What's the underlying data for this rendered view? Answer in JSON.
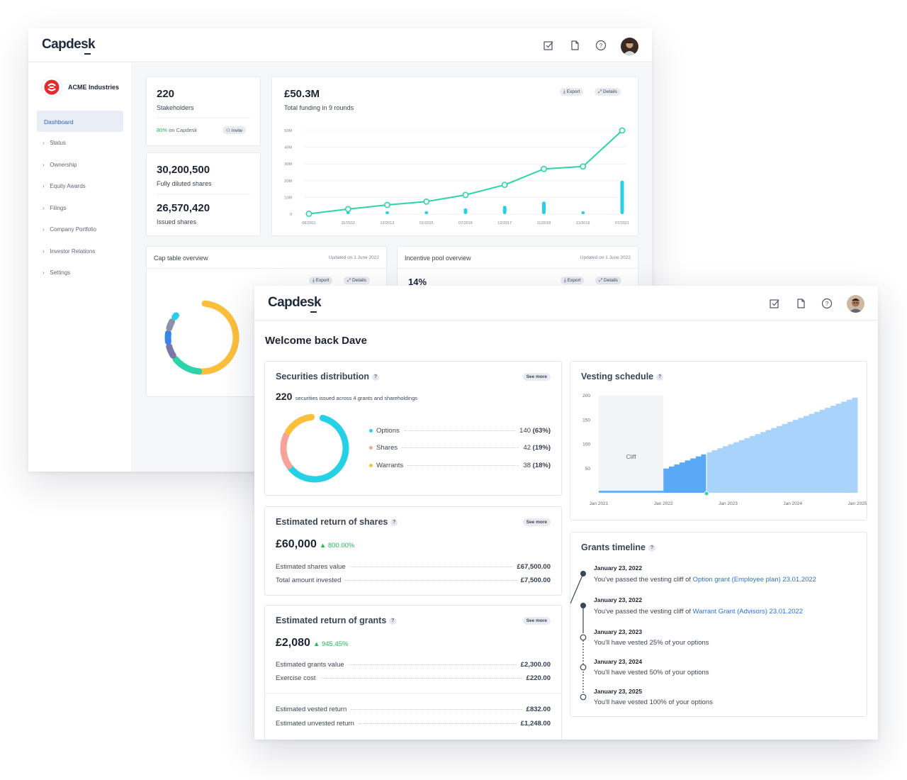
{
  "colors": {
    "teal": "#2dd4a7",
    "cyan": "#26d1e6",
    "accent_blue": "#2e5fc0",
    "amber": "#fbbf3c",
    "salmon": "#f6a39b",
    "green": "#1fba57"
  },
  "back": {
    "logo": "Capdesk",
    "topbar_icons": [
      "checkbox-icon",
      "document-icon",
      "help-icon"
    ],
    "company_name": "ACME Industries",
    "nav": [
      {
        "label": "Dashboard",
        "active": true
      },
      {
        "label": "Status"
      },
      {
        "label": "Ownership"
      },
      {
        "label": "Equity Awards"
      },
      {
        "label": "Filings"
      },
      {
        "label": "Company Portfolio"
      },
      {
        "label": "Investor Relations"
      },
      {
        "label": "Settings"
      }
    ],
    "stakeholders": {
      "value": "220",
      "label": "Stakeholders",
      "pct": "80%",
      "pct_suffix": "on Capdesk",
      "invite": "Invite"
    },
    "shares": {
      "diluted_value": "30,200,500",
      "diluted_label": "Fully diluted shares",
      "issued_value": "26,570,420",
      "issued_label": "Issued shares"
    },
    "funding": {
      "value": "£50.3M",
      "label": "Total funding in 9 rounds",
      "export": "Export",
      "details": "Details"
    },
    "cap_table": {
      "title": "Cap table overview",
      "updated": "Updated on 1 June 2022",
      "export": "Export",
      "details": "Details"
    },
    "incentive": {
      "title": "Incentive pool overview",
      "updated": "Updated on 1 June 2022",
      "value": "14%",
      "export": "Export",
      "details": "Details"
    }
  },
  "chart_data": [
    {
      "type": "line",
      "title": "",
      "x": [
        "08/2011",
        "11/2012",
        "12/2013",
        "01/2015",
        "07/2016",
        "12/2017",
        "11/2018",
        "11/2019",
        "07/2021"
      ],
      "y_ticks": [
        "0",
        "10M",
        "20M",
        "30M",
        "40M",
        "50M"
      ],
      "ylim": [
        0,
        50
      ],
      "series": [
        {
          "type": "line",
          "values": [
            0.2,
            3,
            5.5,
            7.5,
            11.5,
            17.5,
            27,
            28.5,
            50
          ]
        },
        {
          "type": "bar",
          "values": [
            0.3,
            0.8,
            1.5,
            1.8,
            3.5,
            5,
            7.5,
            1.7,
            20
          ]
        }
      ],
      "grid": true
    },
    {
      "type": "bar",
      "title": "Vesting schedule",
      "x_ticks": [
        "Jan 2021",
        "Jan 2022",
        "Jan 2023",
        "Jan 2024",
        "Jan 2025"
      ],
      "y_ticks": [
        "50",
        "100",
        "150",
        "200"
      ],
      "ylim": [
        0,
        200
      ],
      "xlim": [
        "2021-01",
        "2025-01"
      ],
      "annotation": "Cliff",
      "cliff_start": "2022-01",
      "cliff_vested": 50,
      "monthly_step": 4.17,
      "total": 200
    }
  ],
  "front": {
    "logo": "Capdesk",
    "welcome": "Welcome back Dave",
    "securities": {
      "title": "Securities distribution",
      "see_more": "See more",
      "count": "220",
      "caption": "securities issued across 4 grants and shareholdings",
      "items": [
        {
          "label": "Options",
          "value": "140",
          "pct": "(63%)",
          "color": "#26d1e6"
        },
        {
          "label": "Shares",
          "value": "42",
          "pct": "(19%)",
          "color": "#f6a39b"
        },
        {
          "label": "Warrants",
          "value": "38",
          "pct": "(18%)",
          "color": "#fbbf3c"
        }
      ]
    },
    "return_shares": {
      "title": "Estimated return of shares",
      "see_more": "See more",
      "value": "£60,000",
      "change": "▲ 800.00%",
      "rows": [
        {
          "label": "Estimated shares value",
          "value": "£67,500.00"
        },
        {
          "label": "Total amount invested",
          "value": "£7,500.00"
        }
      ]
    },
    "return_grants": {
      "title": "Estimated return of grants",
      "see_more": "See more",
      "value": "£2,080",
      "change": "▲ 945.45%",
      "rows": [
        {
          "label": "Estimated grants value",
          "value": "£2,300.00"
        },
        {
          "label": "Exercise cost",
          "value": "£220.00"
        },
        {
          "label": "Estimated vested return",
          "value": "£832.00"
        },
        {
          "label": "Estimated unvested return",
          "value": "£1,248.00"
        }
      ]
    },
    "vesting": {
      "title": "Vesting schedule"
    },
    "timeline": {
      "title": "Grants timeline",
      "events": [
        {
          "date": "January 23, 2022",
          "text": "You've passed the vesting cliff of ",
          "link": "Option grant (Employee plan) 23.01.2022",
          "past": true
        },
        {
          "date": "January 23, 2022",
          "text": "You've passed the vesting cliff of ",
          "link": "Warrant Grant (Advisors) 23.01.2022",
          "past": true
        },
        {
          "date": "January 23, 2023",
          "text": "You'll have vested 25% of your options",
          "link": "",
          "past": false
        },
        {
          "date": "January 23, 2024",
          "text": "You'll have vested 50% of your options",
          "link": "",
          "past": false
        },
        {
          "date": "January 23, 2025",
          "text": "You'll have vested 100% of your options",
          "link": "",
          "past": false
        }
      ]
    }
  }
}
